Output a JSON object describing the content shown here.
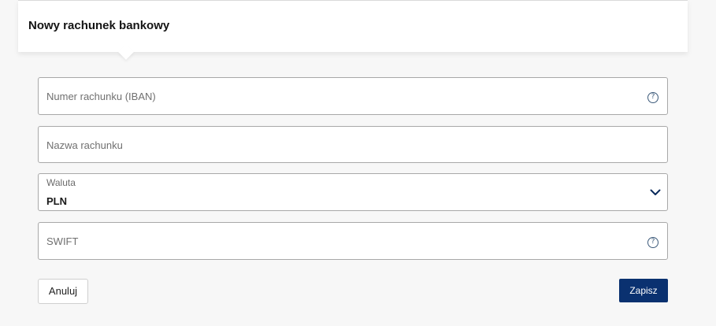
{
  "header": {
    "title": "Nowy rachunek bankowy"
  },
  "form": {
    "iban": {
      "placeholder": "Numer rachunku (IBAN)",
      "help_icon": "question-circle-icon"
    },
    "account_name": {
      "placeholder": "Nazwa rachunku"
    },
    "currency": {
      "label": "Waluta",
      "value": "PLN",
      "dropdown_icon": "chevron-down-icon"
    },
    "swift": {
      "placeholder": "SWIFT",
      "help_icon": "question-circle-icon"
    }
  },
  "buttons": {
    "cancel": "Anuluj",
    "save": "Zapisz"
  },
  "colors": {
    "primary": "#0a3170",
    "background": "#f7f7f7"
  }
}
